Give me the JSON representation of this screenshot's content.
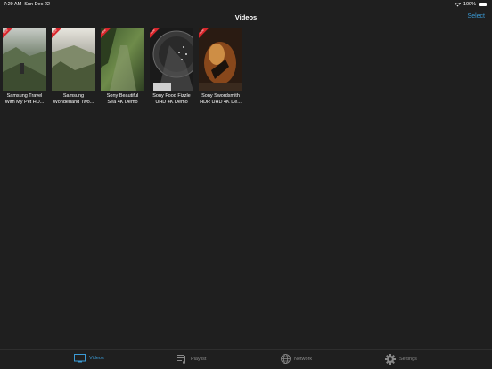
{
  "status": {
    "time": "7:29 AM",
    "date": "Sun Dec 22",
    "battery": "100%"
  },
  "nav": {
    "title": "Videos",
    "select_label": "Select"
  },
  "videos": [
    {
      "line1": "Samsung Travel",
      "line2": "With My Pet HD...",
      "badge": "NEW"
    },
    {
      "line1": "Samsung",
      "line2": "Wonderland Two...",
      "badge": "NEW"
    },
    {
      "line1": "Sony Beautiful",
      "line2": "Sea 4K Demo",
      "badge": "NEW"
    },
    {
      "line1": "Sony Food Fizzle",
      "line2": "UHD 4K Demo",
      "badge": "NEW"
    },
    {
      "line1": "Sony Swordsmith",
      "line2": "HDR UHD 4K De...",
      "badge": "NEW"
    }
  ],
  "tabs": [
    {
      "label": "Videos",
      "icon": "tv-icon"
    },
    {
      "label": "Playlist",
      "icon": "playlist-icon"
    },
    {
      "label": "Network",
      "icon": "globe-icon"
    },
    {
      "label": "Settings",
      "icon": "gear-icon"
    }
  ],
  "colors": {
    "accent": "#3b9bd6",
    "background": "#1f1f1f",
    "badge": "#d9262c",
    "inactive_tab": "#8a8a8a"
  }
}
